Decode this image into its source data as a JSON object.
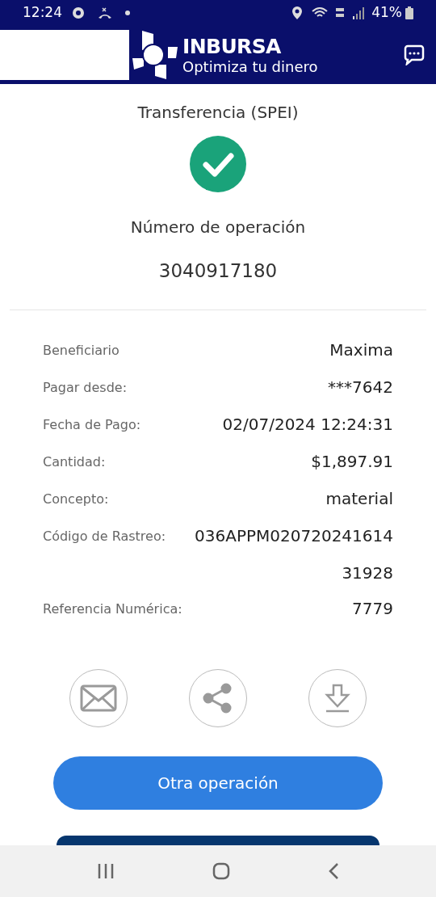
{
  "status_bar": {
    "time": "12:24",
    "battery": "41%"
  },
  "header": {
    "brand": "INBURSA",
    "tagline": "Optimiza tu dinero"
  },
  "receipt": {
    "title": "Transferencia (SPEI)",
    "operation_label": "Número de operación",
    "operation_number": "3040917180",
    "details": [
      {
        "label": "Beneficiario",
        "value": "Maxima"
      },
      {
        "label": "Pagar desde:",
        "value": "***7642"
      },
      {
        "label": "Fecha de Pago:",
        "value": "02/07/2024 12:24:31"
      },
      {
        "label": "Cantidad:",
        "value": "$1,897.91"
      },
      {
        "label": "Concepto:",
        "value": "material"
      },
      {
        "label": "Código de Rastreo:",
        "value": "036APPM020720241614 31928"
      },
      {
        "label": "Referencia Numérica:",
        "value": "7779"
      }
    ]
  },
  "actions": [
    {
      "kind": "email"
    },
    {
      "kind": "share"
    },
    {
      "kind": "download"
    }
  ],
  "primary_button": "Otra operación"
}
